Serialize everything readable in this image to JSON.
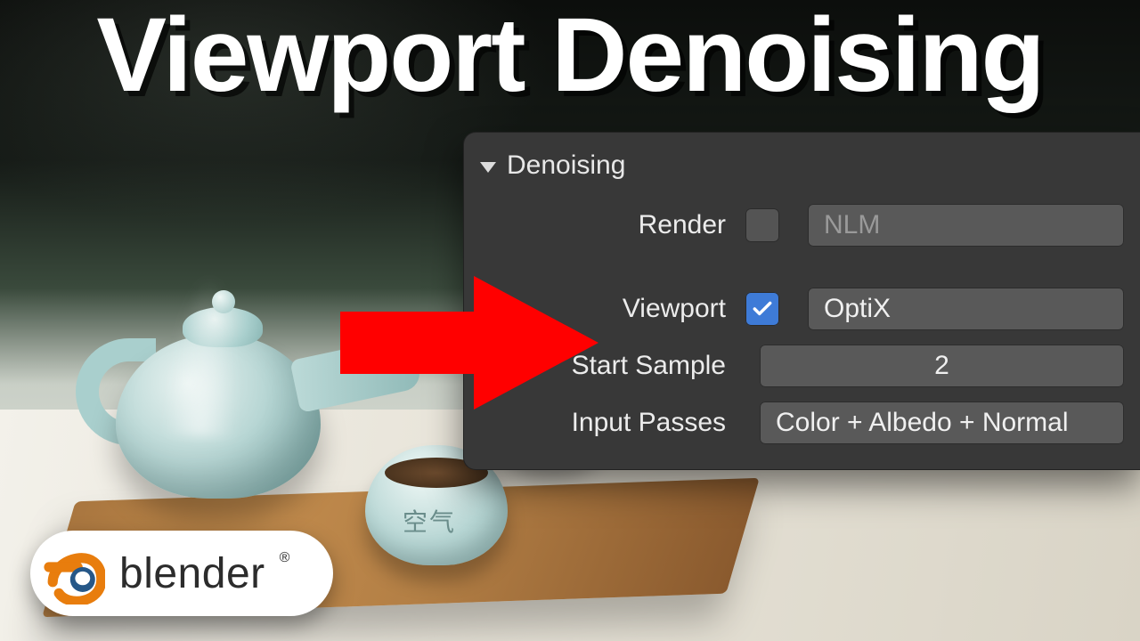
{
  "title": "Viewport Denoising",
  "panel": {
    "section": "Denoising",
    "rows": {
      "render": {
        "label": "Render",
        "checked": false,
        "value": "NLM"
      },
      "viewport": {
        "label": "Viewport",
        "checked": true,
        "value": "OptiX"
      },
      "start_sample": {
        "label": "Start Sample",
        "value": "2"
      },
      "input_passes": {
        "label": "Input Passes",
        "value": "Color + Albedo + Normal"
      }
    }
  },
  "cup_glyph": "空气",
  "badge": {
    "word": "blender",
    "reg": "®"
  },
  "colors": {
    "accent": "#3e7bd7",
    "arrow": "#ff0000",
    "panel_bg": "#383838",
    "logo_orange": "#e87d0d",
    "logo_blue": "#265787"
  }
}
